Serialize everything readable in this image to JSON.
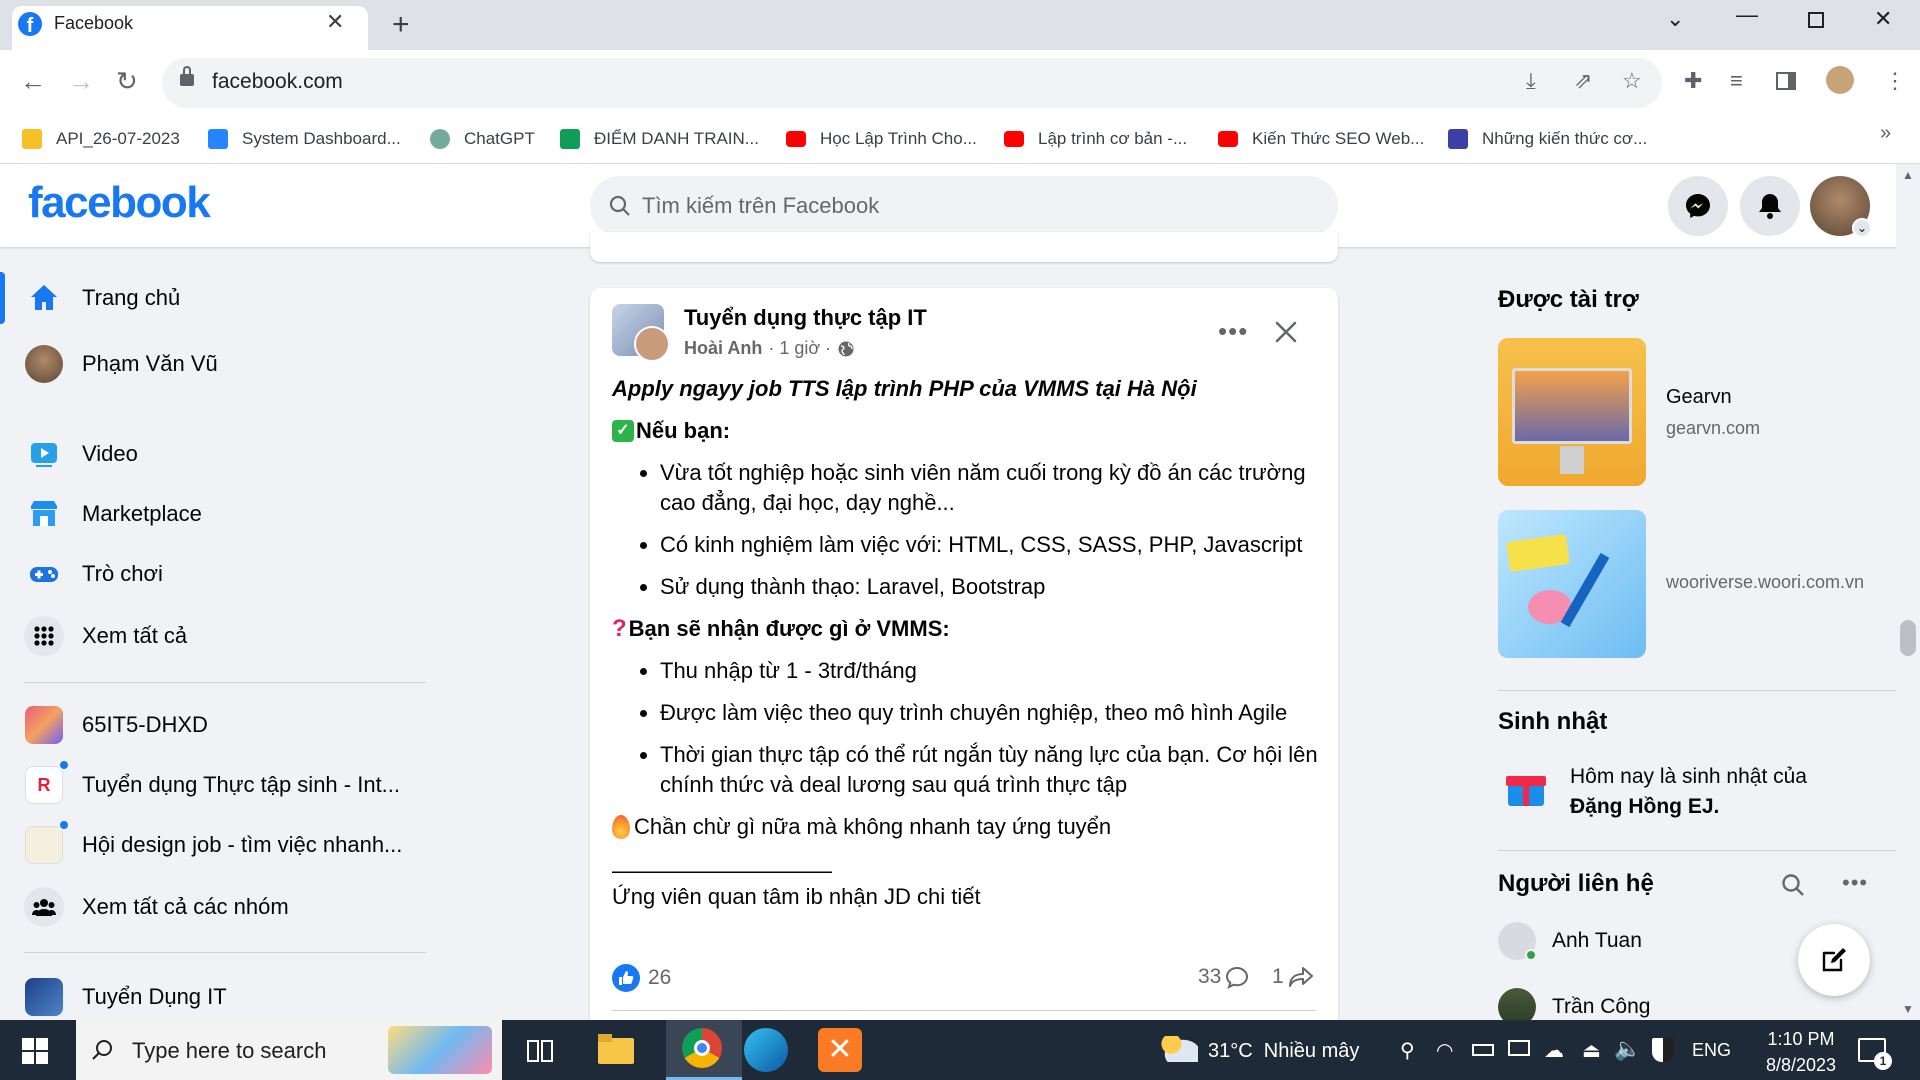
{
  "browser": {
    "tab_title": "Facebook",
    "url": "facebook.com",
    "bookmarks": [
      {
        "label": "API_26-07-2023",
        "color": "#f6c026"
      },
      {
        "label": "System Dashboard...",
        "color": "#2684ff"
      },
      {
        "label": "ChatGPT",
        "color": "#74aa9c"
      },
      {
        "label": "ĐIỂM DANH TRAIN...",
        "color": "#0f9d58"
      },
      {
        "label": "Học Lập Trình Cho...",
        "color": "#ff0000"
      },
      {
        "label": "Lập trình cơ bản -...",
        "color": "#ff0000"
      },
      {
        "label": "Kiến Thức SEO Web...",
        "color": "#ff0000"
      },
      {
        "label": "Những kiến thức cơ...",
        "color": "#3b3fa6"
      }
    ],
    "more_bookmarks": "»"
  },
  "fb": {
    "logo": "facebook",
    "search_placeholder": "Tìm kiếm trên Facebook"
  },
  "sidebar": {
    "items": [
      {
        "label": "Trang chủ"
      },
      {
        "label": "Phạm Văn Vũ"
      },
      {
        "label": "Video"
      },
      {
        "label": "Marketplace"
      },
      {
        "label": "Trò chơi"
      },
      {
        "label": "Xem tất cả"
      },
      {
        "label": "65IT5-DHXD"
      },
      {
        "label": "Tuyển dụng Thực tập sinh - Int..."
      },
      {
        "label": "Hội design job - tìm việc nhanh..."
      },
      {
        "label": "Xem tất cả các nhóm"
      },
      {
        "label": "Tuyển Dụng IT"
      }
    ]
  },
  "post": {
    "group": "Tuyển dụng thực tập IT",
    "author": "Hoài Anh",
    "meta": "· 1 giờ ·",
    "title": "Apply ngayy job TTS lập trình PHP của VMMS tại Hà Nội",
    "section1": "Nếu bạn:",
    "list1": [
      "Vừa tốt nghiệp hoặc sinh viên năm cuối trong kỳ đồ án các trường cao đẳng, đại học, dạy nghề...",
      "Có kinh nghiệm làm việc với: HTML, CSS, SASS, PHP, Javascript",
      "Sử dụng thành thạo: Laravel, Bootstrap"
    ],
    "section2": "Bạn sẽ nhận được gì ở VMMS:",
    "list2": [
      "Thu nhập từ 1 - 3trđ/tháng",
      "Được làm việc theo quy trình chuyên nghiệp, theo mô hình Agile",
      "Thời gian thực tập có thể rút ngắn tùy năng lực của bạn. Cơ hội lên chính thức và deal lương sau quá trình thực tập"
    ],
    "cta": "Chần chừ gì nữa mà không nhanh tay ứng tuyển",
    "divider": "——————————",
    "footer_line": "Ứng viên quan tâm ib nhận JD chi tiết",
    "likes": "26",
    "comments": "33",
    "shares": "1"
  },
  "right": {
    "sponsored_title": "Được tài trợ",
    "ads": [
      {
        "name": "Gearvn",
        "domain": "gearvn.com"
      },
      {
        "name": "",
        "domain": "wooriverse.woori.com.vn"
      }
    ],
    "birthday_title": "Sinh nhật",
    "birthday_text": "Hôm nay là sinh nhật của",
    "birthday_name": "Đặng Hồng EJ.",
    "contacts_title": "Người liên hệ",
    "contacts": [
      {
        "name": "Anh Tuan"
      },
      {
        "name": "Trần Công"
      }
    ]
  },
  "taskbar": {
    "search_placeholder": "Type here to search",
    "weather": "31°C  Nhiều mây",
    "language": "ENG",
    "time": "1:10 PM",
    "date": "8/8/2023",
    "notifications": "1"
  },
  "icons": {
    "tab_favicon": "facebook-f-icon",
    "messenger": "messenger-icon",
    "notifications": "bell-icon"
  },
  "colors": {
    "fb_blue": "#1877f2",
    "background": "#f0f2f5",
    "taskbar": "#1f2a38"
  }
}
